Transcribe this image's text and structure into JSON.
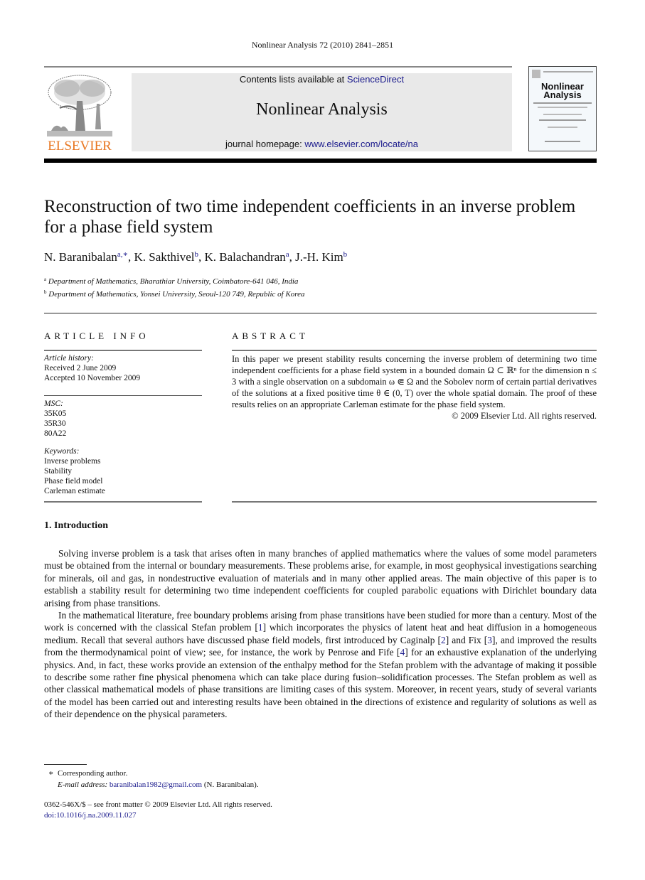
{
  "header": {
    "journal_ref": "Nonlinear Analysis 72 (2010) 2841–2851",
    "contents_prefix": "Contents lists available at ",
    "contents_link": "ScienceDirect",
    "journal_name": "Nonlinear Analysis",
    "homepage_prefix": "journal homepage: ",
    "homepage_link": "www.elsevier.com/locate/na",
    "publisher_logo": "ELSEVIER",
    "cover": {
      "title_line1": "Nonlinear",
      "title_line2": "Analysis"
    },
    "colors": {
      "publisher_orange": "#e87722",
      "link_blue": "#1a1a8c",
      "banner_grey": "#e9e9e9"
    }
  },
  "article": {
    "title": "Reconstruction of two time independent coefficients in an inverse problem for a phase field system",
    "authors": [
      {
        "name": "N. Baranibalan",
        "sup": "a,∗"
      },
      {
        "name": "K. Sakthivel",
        "sup": "b"
      },
      {
        "name": "K. Balachandran",
        "sup": "a"
      },
      {
        "name": "J.-H. Kim",
        "sup": "b"
      }
    ],
    "affiliations": [
      {
        "mark": "a",
        "text": "Department of Mathematics, Bharathiar University, Coimbatore-641 046, India"
      },
      {
        "mark": "b",
        "text": "Department of Mathematics, Yonsei University, Seoul-120 749, Republic of Korea"
      }
    ]
  },
  "article_info": {
    "heading": "ARTICLE INFO",
    "history_label": "Article history:",
    "received": "Received 2 June 2009",
    "accepted": "Accepted 10 November 2009",
    "msc_label": "MSC:",
    "msc": [
      "35K05",
      "35R30",
      "80A22"
    ],
    "keywords_label": "Keywords:",
    "keywords": [
      "Inverse problems",
      "Stability",
      "Phase field model",
      "Carleman estimate"
    ]
  },
  "abstract": {
    "heading": "ABSTRACT",
    "text": "In this paper we present stability results concerning the inverse problem of determining two time independent coefficients for a phase field system in a bounded domain Ω ⊂ ℝⁿ for the dimension n ≤ 3 with a single observation on a subdomain ω ⋐ Ω and the Sobolev norm of certain partial derivatives of the solutions at a fixed positive time θ ∈ (0, T) over the whole spatial domain. The proof of these results relies on an appropriate Carleman estimate for the phase field system.",
    "copyright": "© 2009 Elsevier Ltd. All rights reserved."
  },
  "introduction": {
    "heading": "1.  Introduction",
    "para1": "Solving inverse problem is a task that arises often in many branches of applied mathematics where the values of some model parameters must be obtained from the internal or boundary measurements. These problems arise, for example, in most geophysical investigations searching for minerals, oil and gas, in nondestructive evaluation of materials and in many other applied areas. The main objective of this paper is to establish a stability result for determining two time independent coefficients for coupled parabolic equations with Dirichlet boundary data arising from phase transitions.",
    "para2": [
      {
        "t": "In the mathematical literature, free boundary problems arising from phase transitions have been studied for more than a century. Most of the work is concerned with the classical Stefan problem ["
      },
      {
        "ref": "1"
      },
      {
        "t": "] which incorporates the physics of latent heat and heat diffusion in a homogeneous medium. Recall that several authors have discussed phase field models, first introduced by Caginalp ["
      },
      {
        "ref": "2"
      },
      {
        "t": "] and Fix ["
      },
      {
        "ref": "3"
      },
      {
        "t": "], and improved the results from the thermodynamical point of view; see, for instance, the work by Penrose and Fife ["
      },
      {
        "ref": "4"
      },
      {
        "t": "] for an exhaustive explanation of the underlying physics. And, in fact, these works provide an extension of the enthalpy method for the Stefan problem with the advantage of making it possible to describe some rather fine physical phenomena which can take place during fusion–solidification processes. The Stefan problem as well as other classical mathematical models of phase transitions are limiting cases of this system. Moreover, in recent years, study of several variants of the model has been carried out and interesting results have been obtained in the directions of existence and regularity of solutions as well as of their dependence on the physical parameters."
      }
    ]
  },
  "footnotes": {
    "star": "∗",
    "corresponding": "Corresponding author.",
    "email_label": "E-mail address:",
    "email": "baranibalan1982@gmail.com",
    "email_owner": " (N. Baranibalan).",
    "front_matter": "0362-546X/$ – see front matter © 2009 Elsevier Ltd. All rights reserved.",
    "doi": "doi:10.1016/j.na.2009.11.027"
  }
}
